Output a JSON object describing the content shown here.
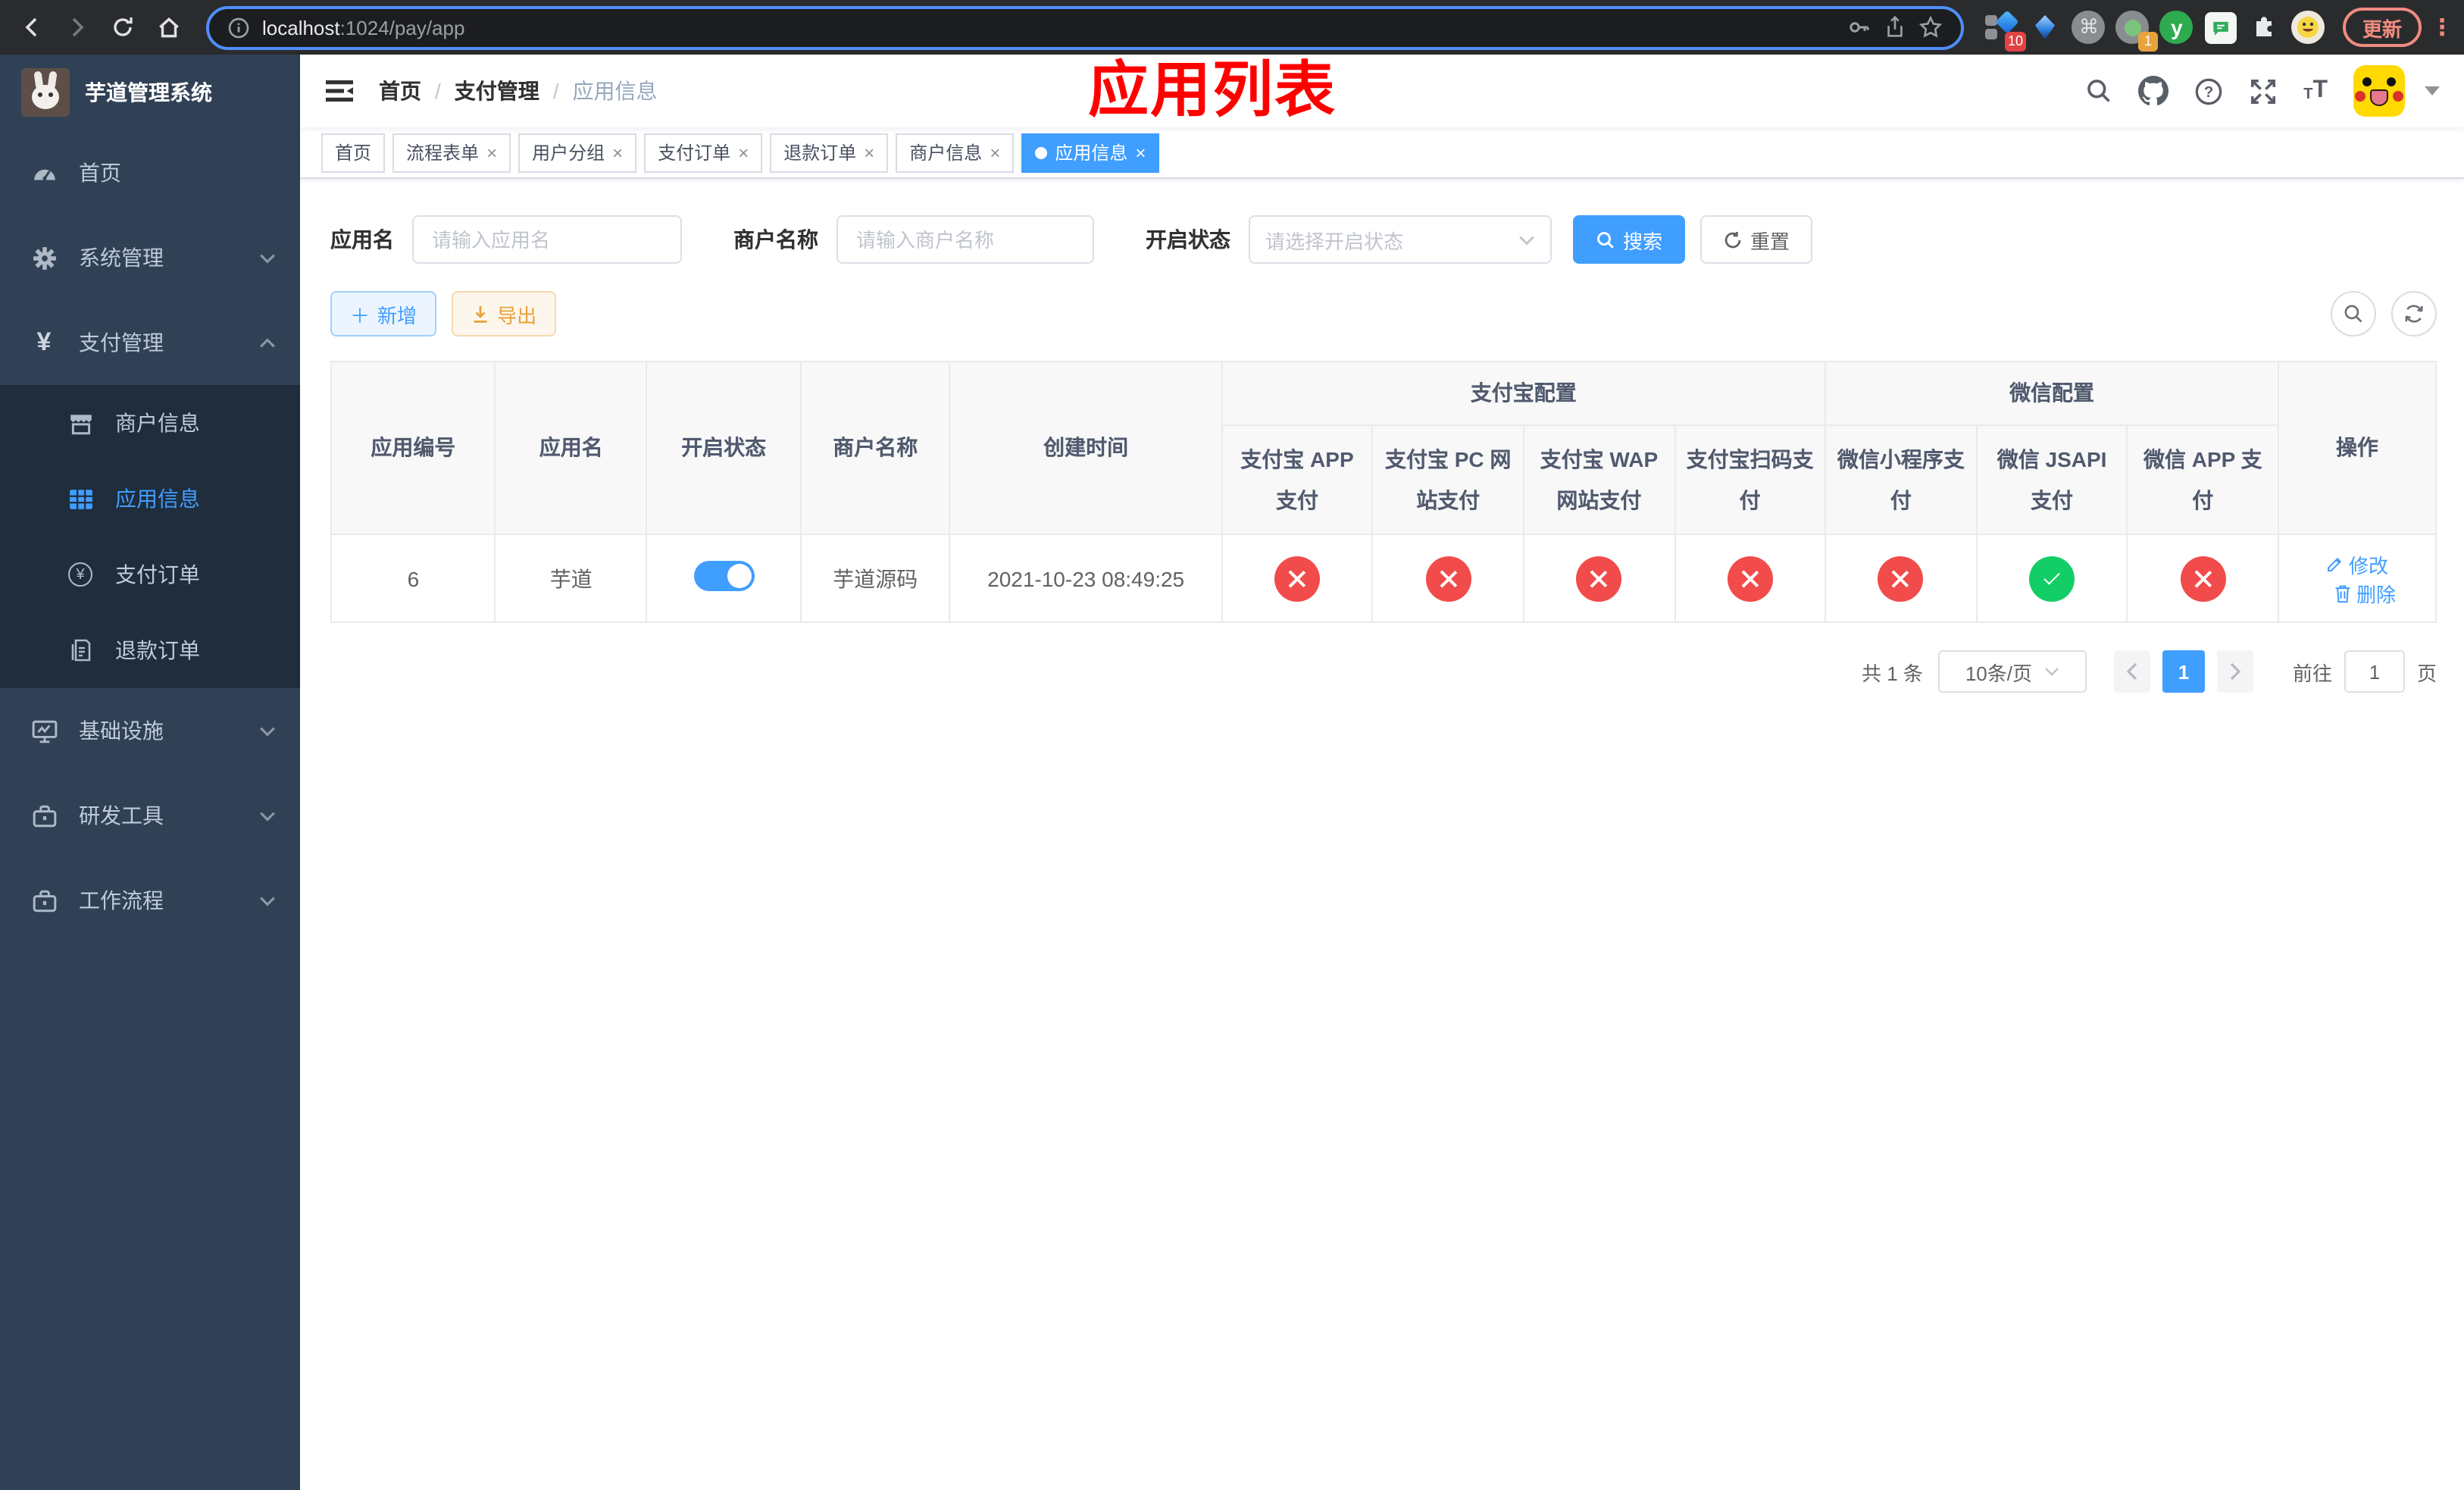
{
  "browser": {
    "url": {
      "host": "localhost",
      "path": ":1024/pay/app"
    },
    "update_button": "更新",
    "ext_badge_first": "10",
    "ext_badge_second": "1",
    "ext_y_label": "y"
  },
  "sidebar": {
    "title": "芋道管理系统",
    "menu": [
      {
        "label": "首页"
      },
      {
        "label": "系统管理"
      },
      {
        "label": "支付管理"
      },
      {
        "label": "基础设施"
      },
      {
        "label": "研发工具"
      },
      {
        "label": "工作流程"
      }
    ],
    "submenu": [
      {
        "label": "商户信息"
      },
      {
        "label": "应用信息"
      },
      {
        "label": "支付订单"
      },
      {
        "label": "退款订单"
      }
    ]
  },
  "navbar": {
    "breadcrumb": [
      "首页",
      "支付管理",
      "应用信息"
    ],
    "annotation": "应用列表"
  },
  "tabs": [
    {
      "label": "首页"
    },
    {
      "label": "流程表单"
    },
    {
      "label": "用户分组"
    },
    {
      "label": "支付订单"
    },
    {
      "label": "退款订单"
    },
    {
      "label": "商户信息"
    },
    {
      "label": "应用信息"
    }
  ],
  "filters": {
    "app_name_label": "应用名",
    "app_name_placeholder": "请输入应用名",
    "merchant_label": "商户名称",
    "merchant_placeholder": "请输入商户名称",
    "status_label": "开启状态",
    "status_placeholder": "请选择开启状态",
    "search_label": "搜索",
    "reset_label": "重置"
  },
  "toolbar": {
    "add_label": "新增",
    "export_label": "导出"
  },
  "table": {
    "col_app_id": "应用编号",
    "col_app_name": "应用名",
    "col_status": "开启状态",
    "col_merchant": "商户名称",
    "col_created": "创建时间",
    "group_alipay": "支付宝配置",
    "group_wechat": "微信配置",
    "sub_columns": [
      "支付宝 APP 支付",
      "支付宝 PC 网站支付",
      "支付宝 WAP 网站支付",
      "支付宝扫码支付",
      "微信小程序支付",
      "微信 JSAPI 支付",
      "微信 APP 支付"
    ],
    "col_actions": "操作",
    "rows": [
      {
        "id": "6",
        "name": "芋道",
        "enabled": true,
        "merchant": "芋道源码",
        "created": "2021-10-23 08:49:25",
        "configs": [
          "closed",
          "closed",
          "closed",
          "closed",
          "closed",
          "open",
          "closed"
        ],
        "edit_label": "修改",
        "delete_label": "删除"
      }
    ]
  },
  "pagination": {
    "total": "共 1 条",
    "page_size": "10条/页",
    "page": "1",
    "goto_label": "前往",
    "goto_value": "1",
    "unit_label": "页"
  },
  "colors": {
    "primary": "#409eff",
    "success": "#13ce66",
    "danger": "#f24b4b",
    "warning": "#e6a23c",
    "annotation": "#ff0000",
    "sidebar_bg": "#304156",
    "submenu_bg": "#1f2d3d"
  }
}
